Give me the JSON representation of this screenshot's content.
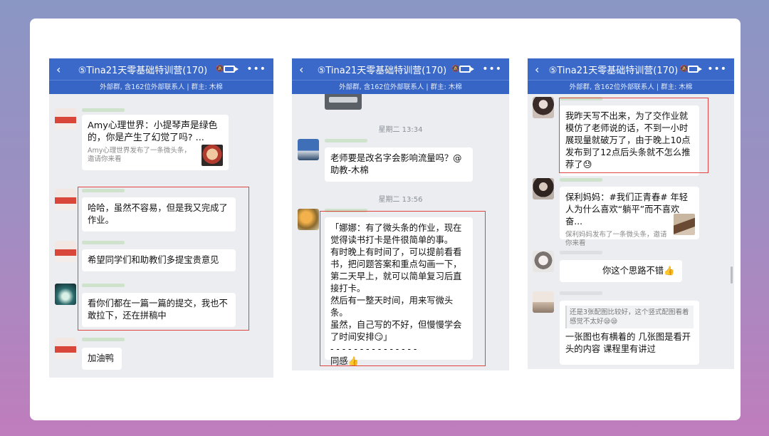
{
  "colors": {
    "nav": "#3b69c9",
    "chat_bg": "#ebedf0",
    "highlight": "#e0443e"
  },
  "panels": [
    {
      "header": {
        "title": "⑤Tina21天零基础特训营(170)",
        "subtitle": "外部群, 含162位外部联系人 | 群主: 木棉"
      },
      "messages": [
        {
          "text": "Amy心理世界：小提琴声是绿色的，你是产生了幻觉了吗? ...",
          "card_text": "Amy心理世界发布了一条微头条，邀请你来看"
        },
        {
          "text": "哈哈，虽然不容易，但是我又完成了作业。"
        },
        {
          "text": "希望同学们和助教们多提宝贵意见"
        },
        {
          "text": "看你们都在一篇一篇的提交，我也不敢拉下，还在拼稿中"
        },
        {
          "text": "加油鸭"
        }
      ]
    },
    {
      "header": {
        "title": "⑤Tina21天零基础特训营(170)",
        "subtitle": "外部群, 含162位外部联系人 | 群主: 木棉"
      },
      "time1": "星期二 13:34",
      "time2": "星期二 13:56",
      "messages": [
        {
          "text": "老师要是改名字会影响流量吗？@助教-木棉"
        },
        {
          "text": "「娜娜：有了微头条的作业，现在觉得读书打卡是件很简单的事。\n有时晚上有时间了，可以提前看看书，把问题答案和重点勾画一下，第二天早上，就可以简单复习后直接打卡。\n然后有一整天时间，用来写微头条。\n虽然，自己写的不好，但慢慢学会了时间安排😏」\n- - - - - - - - - - - - - - -\n同感👍"
        }
      ]
    },
    {
      "header": {
        "title": "⑤Tina21天零基础特训营(170)",
        "subtitle": "外部群, 含162位外部联系人 | 群主: 木棉"
      },
      "messages": [
        {
          "text": "我昨天写不出来，为了交作业就模仿了老师说的话，不到一小时展现量就破万了，由于晚上10点发布到了12点后头条就不怎么推荐了😓"
        },
        {
          "text": "保利妈妈：#我们正青春# 年轻人为什么喜欢“躺平”而不喜欢奋...",
          "card_text": "保利妈妈发布了一条微头条，邀请你来看"
        },
        {
          "text": "你这个思路不错👍"
        },
        {
          "quote": "还是3张配图比较好，这个竖式配图看着感觉不太好😪😪",
          "text": "一张图也有横着的 几张图是看开头的内容 课程里有讲过"
        }
      ]
    }
  ]
}
